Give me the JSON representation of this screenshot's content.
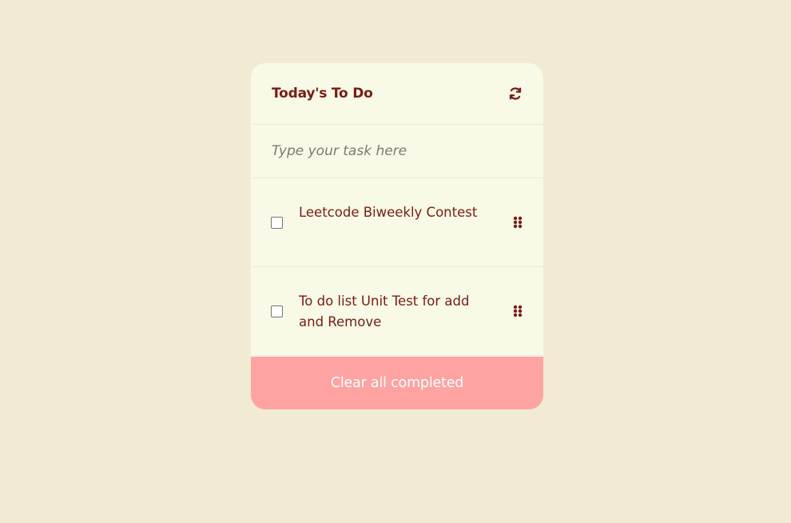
{
  "header": {
    "title": "Today's To Do",
    "refresh_icon": "refresh-icon"
  },
  "input": {
    "placeholder": "Type your task here",
    "value": ""
  },
  "tasks": [
    {
      "text": "Leetcode Biweekly Contest",
      "checked": false,
      "drag_icon": "drag-handle-icon"
    },
    {
      "text": "To do list Unit Test for add and Remove",
      "checked": false,
      "drag_icon": "drag-handle-icon"
    }
  ],
  "footer": {
    "clear_label": "Clear all completed"
  },
  "colors": {
    "page_background": "#f1ebd4",
    "card_background": "#f8f9e6",
    "accent_text": "#7b1c17",
    "footer_background": "#ffa3a2"
  }
}
